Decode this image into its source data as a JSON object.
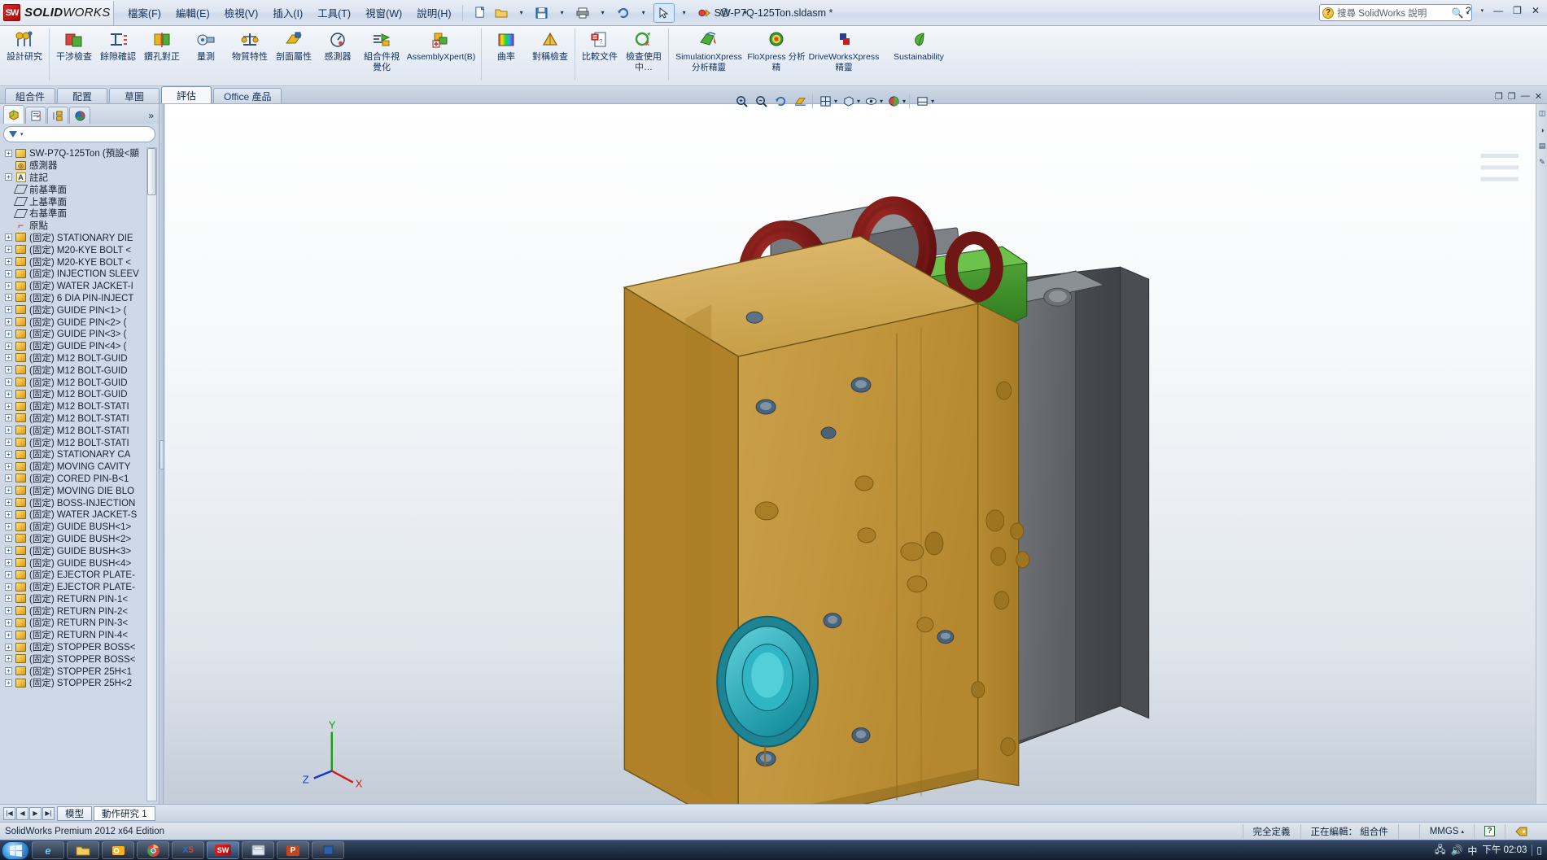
{
  "app": {
    "brand_sw": "SW",
    "brand_solid": "SOLID",
    "brand_works": "WORKS",
    "document_title": "SW-P7Q-125Ton.sldasm *",
    "edition": "SolidWorks Premium 2012 x64 Edition"
  },
  "menu": [
    {
      "label": "檔案(F)",
      "name": "menu-file"
    },
    {
      "label": "編輯(E)",
      "name": "menu-edit"
    },
    {
      "label": "檢視(V)",
      "name": "menu-view"
    },
    {
      "label": "插入(I)",
      "name": "menu-insert"
    },
    {
      "label": "工具(T)",
      "name": "menu-tools"
    },
    {
      "label": "視窗(W)",
      "name": "menu-window"
    },
    {
      "label": "說明(H)",
      "name": "menu-help"
    }
  ],
  "quick_access": [
    {
      "icon": "new-document-icon",
      "glyph": "🗋"
    },
    {
      "icon": "open-folder-icon",
      "glyph": "📂"
    },
    {
      "icon": "dropdown-arrow-icon",
      "glyph": "▾"
    },
    {
      "icon": "save-icon",
      "glyph": "💾"
    },
    {
      "icon": "dropdown-arrow-icon",
      "glyph": "▾"
    },
    {
      "icon": "print-icon",
      "glyph": "🖨"
    },
    {
      "icon": "dropdown-arrow-icon",
      "glyph": "▾"
    },
    {
      "icon": "undo-icon",
      "glyph": "↶"
    },
    {
      "icon": "dropdown-arrow-icon",
      "glyph": "▾"
    },
    {
      "icon": "select-arrow-icon",
      "glyph": "↖"
    },
    {
      "icon": "dropdown-arrow-icon",
      "glyph": "▾"
    },
    {
      "icon": "rebuild-icon",
      "glyph": "🚦"
    },
    {
      "icon": "options-gear-icon",
      "glyph": "⚙"
    },
    {
      "icon": "dropdown-arrow-icon",
      "glyph": "▾"
    }
  ],
  "search": {
    "placeholder": "搜尋 SolidWorks 說明",
    "value": "",
    "icon": "help-search-icon"
  },
  "window_controls": [
    {
      "label": "?",
      "name": "help-button"
    },
    {
      "label": "▾",
      "name": "help-dropdown"
    },
    {
      "label": "—",
      "name": "minimize-button"
    },
    {
      "label": "❐",
      "name": "restore-button"
    },
    {
      "label": "✕",
      "name": "close-button"
    }
  ],
  "ribbon": {
    "groups": [
      {
        "name": "design-study-group",
        "items": [
          {
            "label": "設計研究",
            "icon": "design-study-icon",
            "width": "narrow"
          }
        ]
      },
      {
        "name": "evaluate-tools-group",
        "items": [
          {
            "label": "干涉檢查",
            "icon": "interference-detection-icon",
            "width": "narrow"
          },
          {
            "label": "餘隙確認",
            "icon": "clearance-verification-icon",
            "width": "narrow"
          },
          {
            "label": "鑽孔對正",
            "icon": "hole-alignment-icon",
            "width": "narrow"
          },
          {
            "label": "量測",
            "icon": "measure-icon",
            "width": "narrow"
          },
          {
            "label": "物質特性",
            "icon": "mass-properties-icon",
            "width": "narrow"
          },
          {
            "label": "剖面屬性",
            "icon": "section-properties-icon",
            "width": "narrow"
          },
          {
            "label": "感測器",
            "icon": "sensor-icon",
            "width": "narrow"
          },
          {
            "label": "組合件視覺化",
            "icon": "assembly-visualization-icon",
            "width": "narrow"
          },
          {
            "label": "AssemblyXpert(B)",
            "icon": "assembly-xpert-icon",
            "width": "xwide"
          }
        ]
      },
      {
        "name": "curvature-symmetry-group",
        "items": [
          {
            "label": "曲率",
            "icon": "curvature-icon",
            "width": "narrow"
          },
          {
            "label": "對稱檢查",
            "icon": "symmetry-check-icon",
            "width": "narrow"
          }
        ]
      },
      {
        "name": "compare-group",
        "items": [
          {
            "label": "比較文件",
            "icon": "compare-documents-icon",
            "width": "narrow"
          },
          {
            "label": "檢查使用中…",
            "icon": "check-active-document-icon",
            "width": "narrow"
          }
        ]
      },
      {
        "name": "xpress-products-group",
        "items": [
          {
            "label": "SimulationXpress 分析精靈",
            "icon": "simulationxpress-icon",
            "width": "xwide"
          },
          {
            "label": "FloXpress 分析精",
            "icon": "floxpress-icon",
            "width": "wide"
          },
          {
            "label": "DriveWorksXpress 精靈",
            "icon": "driveworksxpress-icon",
            "width": "xwide"
          },
          {
            "label": "Sustainability",
            "icon": "sustainability-icon",
            "width": "xwide"
          }
        ]
      }
    ]
  },
  "command_tabs": [
    {
      "label": "組合件",
      "name": "tab-assembly",
      "active": false
    },
    {
      "label": "配置",
      "name": "tab-layout",
      "active": false
    },
    {
      "label": "草圖",
      "name": "tab-sketch",
      "active": false
    },
    {
      "label": "評估",
      "name": "tab-evaluate",
      "active": true
    },
    {
      "label": "Office 產品",
      "name": "tab-office-products",
      "active": false
    }
  ],
  "view_toolbar": [
    {
      "icon": "zoom-to-fit-icon",
      "glyph": "⊕"
    },
    {
      "icon": "zoom-to-area-icon",
      "glyph": "⊖"
    },
    {
      "icon": "previous-view-icon",
      "glyph": "↺"
    },
    {
      "icon": "section-view-icon",
      "glyph": "✂"
    },
    {
      "icon": "view-orientation-icon",
      "glyph": "◫"
    },
    {
      "icon": "display-style-icon",
      "glyph": "◰"
    },
    {
      "icon": "hide-show-items-icon",
      "glyph": "◉"
    },
    {
      "icon": "appearances-icon",
      "glyph": "◑"
    },
    {
      "icon": "scene-icon",
      "glyph": "▤"
    }
  ],
  "feature_manager": {
    "tabs": [
      {
        "icon": "feature-manager-tree-icon",
        "name": "tab-featuremanager",
        "active": true
      },
      {
        "icon": "property-manager-icon",
        "name": "tab-propertymanager",
        "active": false
      },
      {
        "icon": "configuration-manager-icon",
        "name": "tab-configurationmanager",
        "active": false
      },
      {
        "icon": "display-manager-icon",
        "name": "tab-displaymanager",
        "active": false
      }
    ],
    "more_label": "»",
    "filter_placeholder": "",
    "root": "SW-P7Q-125Ton (預設<顯",
    "items": [
      {
        "label": "感測器",
        "icon": "sensor-folder-icon",
        "expandable": false,
        "indent": 1
      },
      {
        "label": "註記",
        "icon": "annotations-icon",
        "expandable": true,
        "indent": 1
      },
      {
        "label": "前基準面",
        "icon": "plane-icon",
        "expandable": false,
        "indent": 1
      },
      {
        "label": "上基準面",
        "icon": "plane-icon",
        "expandable": false,
        "indent": 1
      },
      {
        "label": "右基準面",
        "icon": "plane-icon",
        "expandable": false,
        "indent": 1
      },
      {
        "label": "原點",
        "icon": "origin-icon",
        "expandable": false,
        "indent": 1
      },
      {
        "label": "(固定) STATIONARY DIE",
        "icon": "part-icon",
        "expandable": true,
        "indent": 1
      },
      {
        "label": "(固定) M20-KYE BOLT <",
        "icon": "part-icon",
        "expandable": true,
        "indent": 1
      },
      {
        "label": "(固定) M20-KYE BOLT <",
        "icon": "part-icon",
        "expandable": true,
        "indent": 1
      },
      {
        "label": "(固定) INJECTION SLEEV",
        "icon": "part-icon",
        "expandable": true,
        "indent": 1
      },
      {
        "label": "(固定) WATER JACKET-I",
        "icon": "part-icon",
        "expandable": true,
        "indent": 1
      },
      {
        "label": "(固定) 6 DIA PIN-INJECT",
        "icon": "part-icon",
        "expandable": true,
        "indent": 1
      },
      {
        "label": "(固定) GUIDE PIN<1> (",
        "icon": "part-icon",
        "expandable": true,
        "indent": 1
      },
      {
        "label": "(固定) GUIDE PIN<2> (",
        "icon": "part-icon",
        "expandable": true,
        "indent": 1
      },
      {
        "label": "(固定) GUIDE PIN<3> (",
        "icon": "part-icon",
        "expandable": true,
        "indent": 1
      },
      {
        "label": "(固定) GUIDE PIN<4> (",
        "icon": "part-icon",
        "expandable": true,
        "indent": 1
      },
      {
        "label": "(固定) M12 BOLT-GUID",
        "icon": "part-icon",
        "expandable": true,
        "indent": 1
      },
      {
        "label": "(固定) M12 BOLT-GUID",
        "icon": "part-icon",
        "expandable": true,
        "indent": 1
      },
      {
        "label": "(固定) M12 BOLT-GUID",
        "icon": "part-icon",
        "expandable": true,
        "indent": 1
      },
      {
        "label": "(固定) M12 BOLT-GUID",
        "icon": "part-icon",
        "expandable": true,
        "indent": 1
      },
      {
        "label": "(固定) M12 BOLT-STATI",
        "icon": "part-icon",
        "expandable": true,
        "indent": 1
      },
      {
        "label": "(固定) M12 BOLT-STATI",
        "icon": "part-icon",
        "expandable": true,
        "indent": 1
      },
      {
        "label": "(固定) M12 BOLT-STATI",
        "icon": "part-icon",
        "expandable": true,
        "indent": 1
      },
      {
        "label": "(固定) M12 BOLT-STATI",
        "icon": "part-icon",
        "expandable": true,
        "indent": 1
      },
      {
        "label": "(固定) STATIONARY CA",
        "icon": "part-icon",
        "expandable": true,
        "indent": 1
      },
      {
        "label": "(固定) MOVING CAVITY",
        "icon": "part-icon",
        "expandable": true,
        "indent": 1
      },
      {
        "label": "(固定) CORED PIN-B<1",
        "icon": "part-icon",
        "expandable": true,
        "indent": 1
      },
      {
        "label": "(固定) MOVING DIE BLO",
        "icon": "part-icon",
        "expandable": true,
        "indent": 1
      },
      {
        "label": "(固定) BOSS-INJECTION",
        "icon": "part-icon",
        "expandable": true,
        "indent": 1
      },
      {
        "label": "(固定) WATER JACKET-S",
        "icon": "part-icon",
        "expandable": true,
        "indent": 1
      },
      {
        "label": "(固定) GUIDE BUSH<1>",
        "icon": "part-icon",
        "expandable": true,
        "indent": 1
      },
      {
        "label": "(固定) GUIDE BUSH<2>",
        "icon": "part-icon",
        "expandable": true,
        "indent": 1
      },
      {
        "label": "(固定) GUIDE BUSH<3>",
        "icon": "part-icon",
        "expandable": true,
        "indent": 1
      },
      {
        "label": "(固定) GUIDE BUSH<4>",
        "icon": "part-icon",
        "expandable": true,
        "indent": 1
      },
      {
        "label": "(固定) EJECTOR PLATE-",
        "icon": "part-icon",
        "expandable": true,
        "indent": 1
      },
      {
        "label": "(固定) EJECTOR PLATE-",
        "icon": "part-icon",
        "expandable": true,
        "indent": 1
      },
      {
        "label": "(固定) RETURN PIN-1<",
        "icon": "part-icon",
        "expandable": true,
        "indent": 1
      },
      {
        "label": "(固定) RETURN PIN-2<",
        "icon": "part-icon",
        "expandable": true,
        "indent": 1
      },
      {
        "label": "(固定) RETURN PIN-3<",
        "icon": "part-icon",
        "expandable": true,
        "indent": 1
      },
      {
        "label": "(固定) RETURN PIN-4<",
        "icon": "part-icon",
        "expandable": true,
        "indent": 1
      },
      {
        "label": "(固定) STOPPER BOSS<",
        "icon": "part-icon",
        "expandable": true,
        "indent": 1
      },
      {
        "label": "(固定) STOPPER BOSS<",
        "icon": "part-icon",
        "expandable": true,
        "indent": 1
      },
      {
        "label": "(固定) STOPPER 25H<1",
        "icon": "part-icon",
        "expandable": true,
        "indent": 1
      },
      {
        "label": "(固定) STOPPER 25H<2",
        "icon": "part-icon",
        "expandable": true,
        "indent": 1
      }
    ]
  },
  "bottom_tabs": {
    "nav": [
      "|◀",
      "◀",
      "▶",
      "▶|"
    ],
    "tabs": [
      {
        "label": "模型",
        "name": "tab-model",
        "active": false
      },
      {
        "label": "動作研究 1",
        "name": "tab-motion-study-1",
        "active": true
      }
    ]
  },
  "status_bar": {
    "left": "SolidWorks Premium 2012 x64 Edition",
    "cells": [
      {
        "label": "完全定義",
        "name": "status-fully-defined"
      },
      {
        "label": "正在編輯： 組合件",
        "name": "status-editing-assembly"
      },
      {
        "label": "",
        "name": "status-blank"
      },
      {
        "label": "MMGS",
        "name": "status-unit-system"
      },
      {
        "label": "?",
        "name": "status-help-toggle"
      },
      {
        "label": "",
        "name": "status-tag-icon"
      }
    ]
  },
  "triad": {
    "x_label": "X",
    "y_label": "Y",
    "z_label": "Z",
    "x_color": "#d11a1a",
    "y_color": "#13a013",
    "z_color": "#1a33d1"
  },
  "model": {
    "colors": {
      "die_block_gold": "#c59a3d",
      "die_block_gold_light": "#d9b25a",
      "die_block_gold_dark": "#a87f28",
      "eyebolt_red": "#8b1a18",
      "eyebolt_red_dark": "#5e0f0e",
      "grey_plate": "#6e7276",
      "grey_plate_dark": "#4c5054",
      "green_part": "#3e8f2f",
      "teal_bore": "#1f9fae",
      "teal_bore_light": "#49c4cf"
    }
  },
  "right_rail": [
    {
      "icon": "view-palette-icon"
    },
    {
      "icon": "appearances-palette-icon"
    },
    {
      "icon": "scenes-palette-icon"
    },
    {
      "icon": "custom-properties-icon"
    }
  ],
  "taskbar": {
    "start": "start-orb-icon",
    "buttons": [
      {
        "icon": "internet-explorer-icon",
        "glyph": "e"
      },
      {
        "icon": "windows-explorer-icon",
        "glyph": "📁"
      },
      {
        "icon": "outlook-icon",
        "glyph": "✉"
      },
      {
        "icon": "chrome-icon",
        "glyph": "◉"
      },
      {
        "icon": "youtube-downloader-icon",
        "glyph": "X5"
      },
      {
        "icon": "solidworks-taskbar-icon",
        "glyph": "SW"
      },
      {
        "icon": "calculator-icon",
        "glyph": "▭"
      },
      {
        "icon": "powerpoint-icon",
        "glyph": "P"
      },
      {
        "icon": "app-icon",
        "glyph": "◼"
      }
    ],
    "tray": [
      {
        "icon": "network-icon",
        "glyph": "🖧"
      },
      {
        "icon": "volume-icon",
        "glyph": "🔊"
      },
      {
        "icon": "input-method-icon",
        "glyph": "中"
      },
      {
        "icon": "show-desktop-icon",
        "glyph": "▯"
      }
    ],
    "clock": "下午 02:03"
  }
}
